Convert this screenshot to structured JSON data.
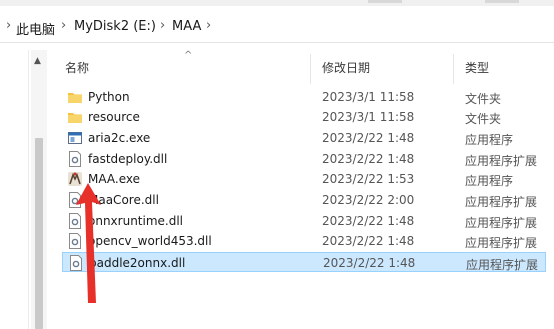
{
  "breadcrumb": {
    "items": [
      "此电脑",
      "MyDisk2 (E:)",
      "MAA"
    ],
    "separator": "›"
  },
  "columns": {
    "name": "名称",
    "modified": "修改日期",
    "type": "类型"
  },
  "files": [
    {
      "name": "Python",
      "date": "2023/3/1 11:58",
      "type": "文件夹",
      "icon": "folder-icon"
    },
    {
      "name": "resource",
      "date": "2023/3/1 11:58",
      "type": "文件夹",
      "icon": "folder-icon"
    },
    {
      "name": "aria2c.exe",
      "date": "2023/2/22 1:48",
      "type": "应用程序",
      "icon": "exe-icon"
    },
    {
      "name": "fastdeploy.dll",
      "date": "2023/2/22 1:48",
      "type": "应用程序扩展",
      "icon": "dll-icon"
    },
    {
      "name": "MAA.exe",
      "date": "2023/2/22 1:53",
      "type": "应用程序",
      "icon": "maa-app-icon"
    },
    {
      "name": "MaaCore.dll",
      "date": "2023/2/22 2:00",
      "type": "应用程序扩展",
      "icon": "dll-icon"
    },
    {
      "name": "onnxruntime.dll",
      "date": "2023/2/22 1:48",
      "type": "应用程序扩展",
      "icon": "dll-icon"
    },
    {
      "name": "opencv_world453.dll",
      "date": "2023/2/22 1:48",
      "type": "应用程序扩展",
      "icon": "dll-icon"
    },
    {
      "name": "paddle2onnx.dll",
      "date": "2023/2/22 1:48",
      "type": "应用程序扩展",
      "icon": "dll-icon"
    }
  ],
  "selected_file": "paddle2onnx.dll",
  "colors": {
    "selection": "#cce8ff",
    "selection_border": "#99d1ff",
    "annotation_arrow": "#e8302a",
    "folder": "#f5c342"
  }
}
